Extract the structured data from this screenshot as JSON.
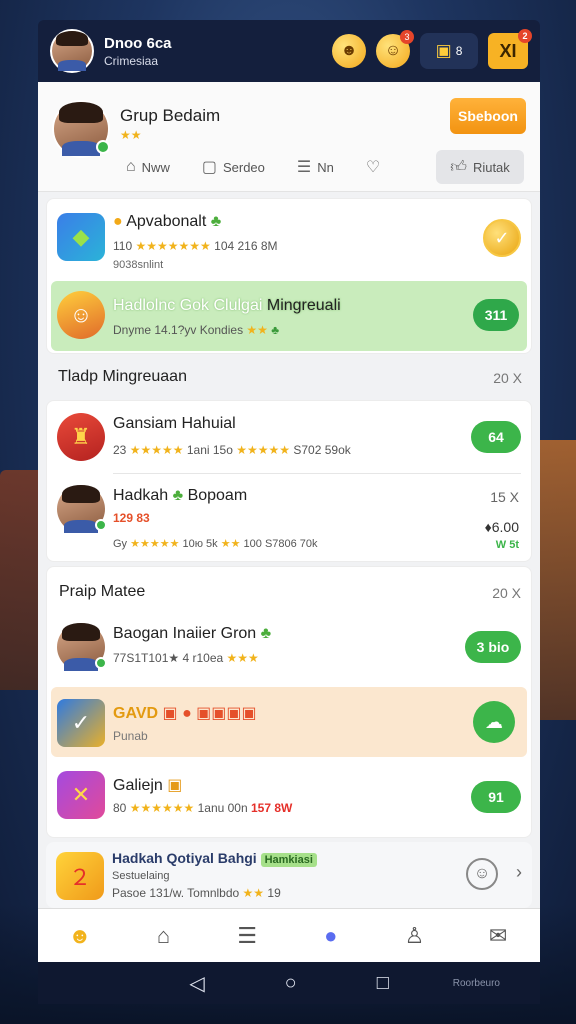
{
  "topbar": {
    "user_name": "Dnoo 6ca",
    "user_sub": "Crimesiaa",
    "badge_count_1": "3",
    "close_label": "XI",
    "close_badge": "2",
    "gift_label": "8"
  },
  "group": {
    "title": "Grup Bedaim",
    "stars": "★★",
    "join_label": "Sbeboon",
    "tabs": [
      "Nww",
      "Serdeo",
      "Nn",
      ""
    ],
    "action_label": "Riutak"
  },
  "card1": {
    "row1": {
      "title": "Apvabonalt",
      "sub_prefix": "110",
      "stars": "★★★★★★★",
      "sub_suffix": "104 216 8M",
      "extra": "9038snlint"
    },
    "row2": {
      "title": "Hadlolnc Gok Clulgai",
      "title_suffix": "Mingreuali",
      "sub": "Dnyme 14.1?yv Kondies",
      "stars": "★★",
      "pill": "311"
    }
  },
  "section1": {
    "title": "Tladp Mingreuaan",
    "meta": "20 X"
  },
  "card2": {
    "row1": {
      "title": "Gansiam Hahuial",
      "sub_prefix": "23",
      "stars": "★★★★★",
      "sub_mid": "1ani 15o",
      "stars2": "★★★★★",
      "sub_suffix": "S702 59ok",
      "pill": "64"
    },
    "row2": {
      "title": "Hadkah",
      "title_suffix": "Bopoam",
      "sub": "129 83",
      "meta": "15 X",
      "price": "6.00",
      "sub2_prefix": "Gy",
      "stars": "★★★★★",
      "sub2_mid": "10ю 5k",
      "stars2": "★★",
      "sub2_suffix": "100 S7806 70k",
      "price_sub": "W 5t"
    }
  },
  "section2": {
    "title": "Praip Matee",
    "meta": "20 X"
  },
  "card3": {
    "row1": {
      "title": "Baogan Inaiier Gron",
      "sub": "77S1T101★ 4 r10ea",
      "stars": "★★★",
      "pill": "3 bio"
    },
    "row2": {
      "title": "GAVD",
      "sub": "Punab"
    },
    "row3": {
      "title": "Galiejn",
      "sub_prefix": "80",
      "stars": "★★★★★★",
      "sub_mid": "1anu 00n",
      "sub_suffix": "157 8W",
      "pill": "91"
    },
    "row4": {
      "title": "Hadkah Qotiyal Bahgi",
      "tag": "Hamkiasi",
      "sub": "Sestuelaing",
      "sub2": "Pasoe 131/w. Tomnlbdo",
      "stars": "★★",
      "sub2_suffix": "19"
    }
  },
  "nav": {
    "brand": "Roorbeuro"
  }
}
